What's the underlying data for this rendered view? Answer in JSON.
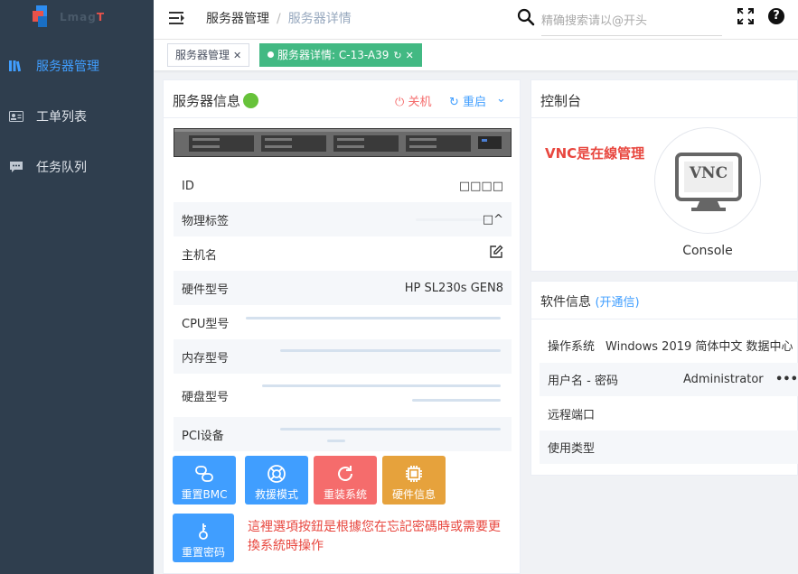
{
  "app": {
    "logo_prefix": "Lmag",
    "logo_suffix": "T"
  },
  "sidebar": {
    "items": [
      {
        "label": "服务器管理",
        "icon": "books-icon",
        "active": true
      },
      {
        "label": "工单列表",
        "icon": "id-card-icon",
        "active": false
      },
      {
        "label": "任务队列",
        "icon": "chat-icon",
        "active": false
      }
    ]
  },
  "header": {
    "breadcrumb": [
      "服务器管理",
      "服务器详情"
    ],
    "search_placeholder": "精确搜索请以@开头"
  },
  "tabs": [
    {
      "label": "服务器管理",
      "active": false
    },
    {
      "label": "服务器详情: C-13-A39",
      "active": true
    }
  ],
  "server_info": {
    "title": "服务器信息",
    "shutdown_label": "关机",
    "restart_label": "重启",
    "rows": [
      {
        "label": "ID",
        "value": "□□□□"
      },
      {
        "label": "物理标签",
        "value": "□^"
      },
      {
        "label": "主机名",
        "value": ""
      },
      {
        "label": "硬件型号",
        "value": "HP SL230s GEN8"
      },
      {
        "label": "CPU型号",
        "value": ""
      },
      {
        "label": "内存型号",
        "value": ""
      },
      {
        "label": "硬盘型号",
        "value": ""
      },
      {
        "label": "PCI设备",
        "value": ""
      }
    ],
    "actions": [
      {
        "label": "重置BMC",
        "color": "#409eff"
      },
      {
        "label": "救援模式",
        "color": "#409eff"
      },
      {
        "label": "重装系统",
        "color": "#f56c6c"
      },
      {
        "label": "硬件信息",
        "color": "#e6a23c"
      },
      {
        "label": "重置密码",
        "color": "#409eff"
      }
    ],
    "annotation": "這裡選項按鈕是根據您在忘記密碼時或需要更換系統時操作"
  },
  "console": {
    "title": "控制台",
    "annotation": "VNC是在線管理",
    "vnc_text": "VNC",
    "label": "Console"
  },
  "software_info": {
    "title": "软件信息",
    "link": "(开通信)",
    "rows": [
      {
        "label": "操作系统",
        "value": "Windows 2019 简体中文 数据中心"
      },
      {
        "label": "用户名 - 密码",
        "value": "Administrator",
        "secret": "••••••"
      },
      {
        "label": "远程端口",
        "value": ""
      },
      {
        "label": "使用类型",
        "value": ""
      }
    ]
  },
  "colors": {
    "sidebar_bg": "#2f3e4e",
    "accent": "#409eff",
    "success": "#67c23a",
    "danger": "#f56c6c",
    "warning": "#e6a23c",
    "tag_active": "#42b983"
  }
}
